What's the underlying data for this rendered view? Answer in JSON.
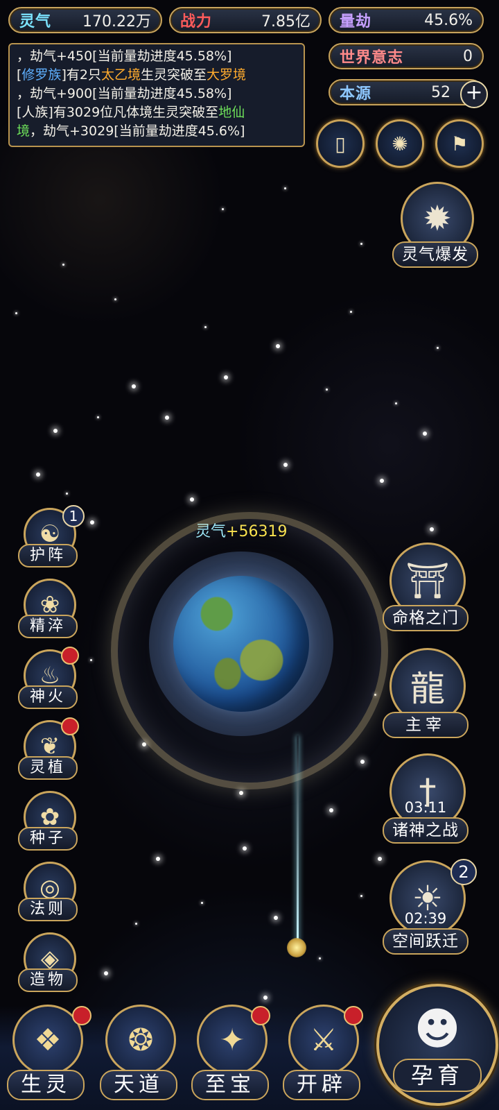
{
  "stats": {
    "lingqi_label": "灵气",
    "lingqi_value": "170.22万",
    "zhanli_label": "战力",
    "zhanli_value": "7.85亿",
    "liangjie_label": "量劫",
    "liangjie_value": "45.6%",
    "shijie_label": "世界意志",
    "shijie_value": "0",
    "benyuan_label": "本源",
    "benyuan_value": "52",
    "add_symbol": "+"
  },
  "log": {
    "l1": "，劫气+450[当前量劫进度45.58%]",
    "l2a": "[",
    "l2b": "修罗族",
    "l2c": "]有2只",
    "l2d": "太乙境",
    "l2e": "生灵突破至",
    "l2f": "大罗境",
    "l3": "，劫气+900[当前量劫进度45.58%]",
    "l4a": "[人族]有3029位凡体境生灵突破至",
    "l4b": "地仙",
    "l5a": "境",
    "l5b": "，劫气+3029[当前量劫进度45.6%]"
  },
  "left_menu": [
    {
      "label": "护阵",
      "badge": "1"
    },
    {
      "label": "精淬"
    },
    {
      "label": "神火"
    },
    {
      "label": "灵植"
    },
    {
      "label": "种子"
    },
    {
      "label": "法则"
    },
    {
      "label": "造物"
    }
  ],
  "right_menu": {
    "burst": "灵气爆发",
    "gate": "命格之门",
    "master": "主宰",
    "war": "诸神之战",
    "war_timer": "03:11",
    "jump": "空间跃迁",
    "jump_timer": "02:39",
    "jump_badge": "2"
  },
  "floating": {
    "prefix": "灵气",
    "amount": "+56319"
  },
  "bottom_nav": [
    "生灵",
    "天道",
    "至宝",
    "开辟"
  ],
  "main_action": "孕育",
  "colors": {
    "gold": "#caa55c",
    "alert": "#c8202a",
    "lingqi": "#7be3ff",
    "zhanli": "#ff5b5b",
    "liangjie": "#b58bff"
  }
}
